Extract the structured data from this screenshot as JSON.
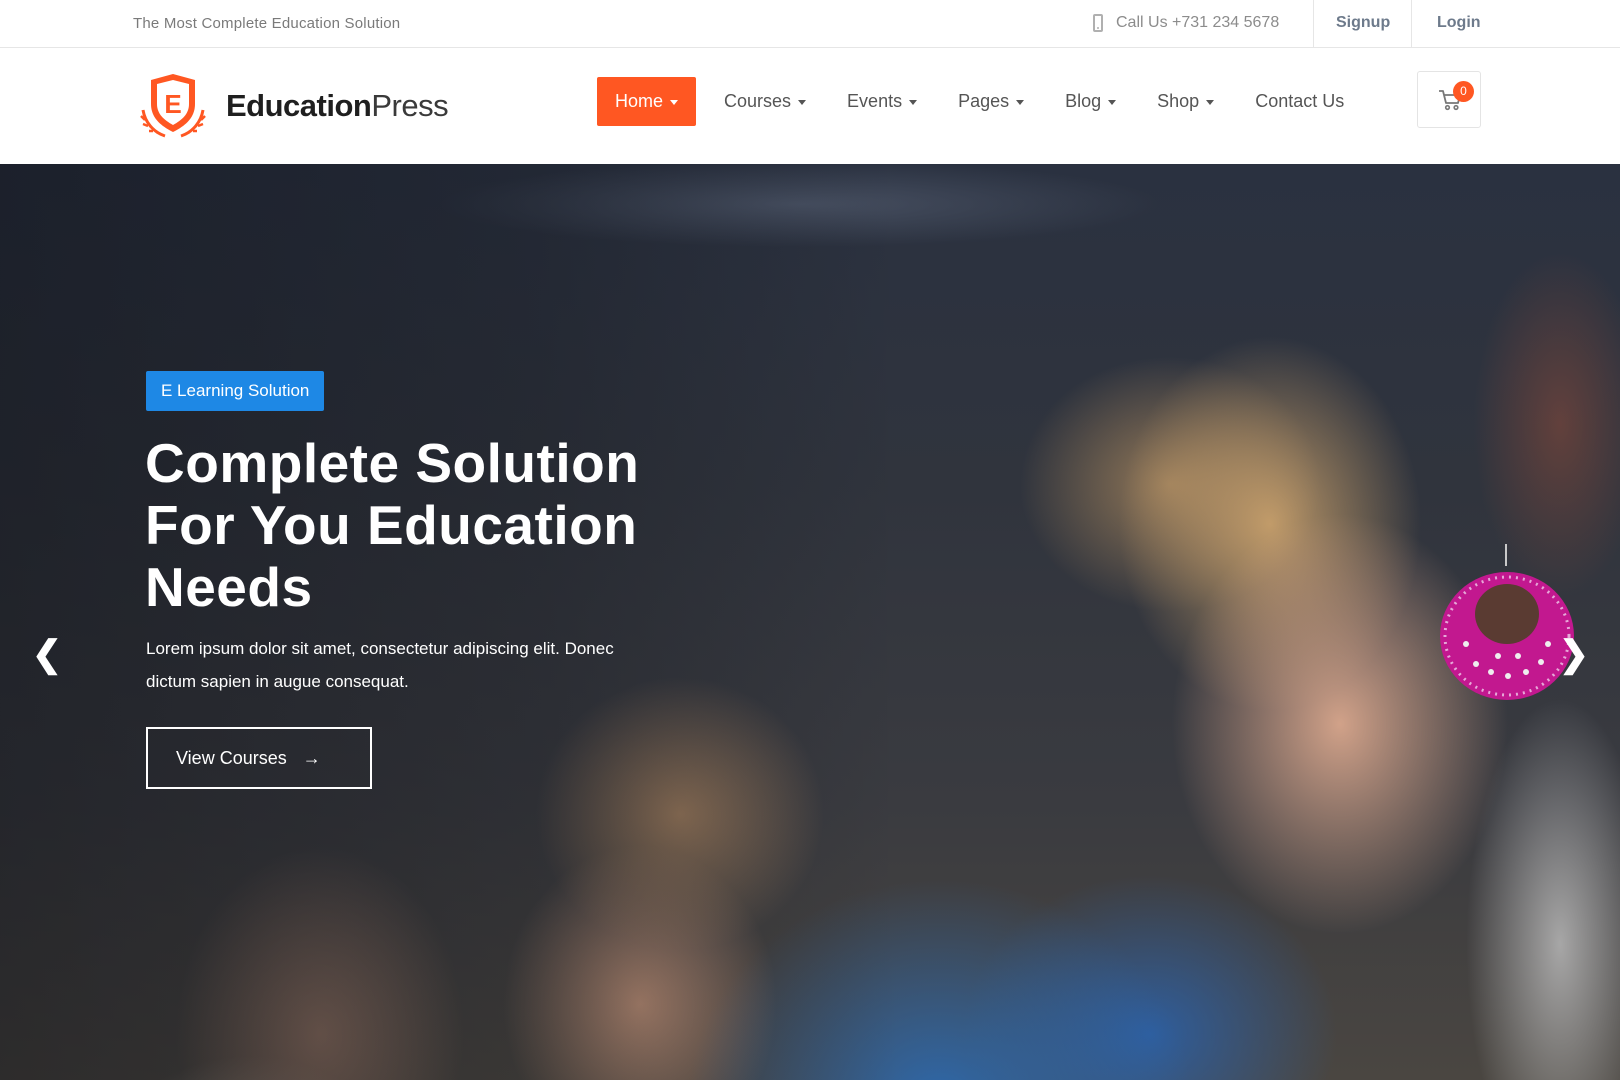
{
  "topbar": {
    "tagline": "The Most Complete Education Solution",
    "call": "Call Us +731 234 5678",
    "signup": "Signup",
    "login": "Login"
  },
  "header": {
    "logo_letter": "E",
    "brand_bold": "Education",
    "brand_light": "Press",
    "nav": [
      {
        "label": "Home",
        "active": true,
        "dropdown": true
      },
      {
        "label": "Courses",
        "dropdown": true
      },
      {
        "label": "Events",
        "dropdown": true
      },
      {
        "label": "Pages",
        "dropdown": true
      },
      {
        "label": "Blog",
        "dropdown": true
      },
      {
        "label": "Shop",
        "dropdown": true
      },
      {
        "label": "Contact Us",
        "dropdown": false
      }
    ],
    "cart_count": "0"
  },
  "hero": {
    "badge": "E Learning Solution",
    "title_line1": "Complete Solution",
    "title_line2": "For You Education",
    "title_line3": "Needs",
    "description_line1": "Lorem ipsum dolor sit amet, consectetur adipiscing elit. Donec",
    "description_line2": "dictum sapien in augue consequat.",
    "cta_label": "View Courses",
    "prev_icon": "chevron-left-icon",
    "next_icon": "chevron-right-icon"
  },
  "colors": {
    "accent": "#ff5722",
    "badge_blue": "#1e88e5"
  }
}
